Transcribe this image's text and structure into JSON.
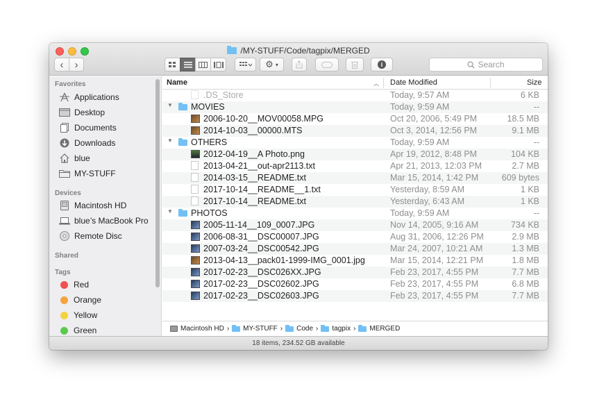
{
  "window": {
    "title": "/MY-STUFF/Code/tagpix/MERGED"
  },
  "toolbar": {
    "back": "‹",
    "forward": "›",
    "search_placeholder": "Search"
  },
  "sidebar": {
    "favorites_label": "Favorites",
    "favorites": [
      {
        "label": "Applications",
        "icon": "applications-icon"
      },
      {
        "label": "Desktop",
        "icon": "desktop-icon"
      },
      {
        "label": "Documents",
        "icon": "documents-icon"
      },
      {
        "label": "Downloads",
        "icon": "downloads-icon"
      },
      {
        "label": "blue",
        "icon": "home-icon"
      },
      {
        "label": "MY-STUFF",
        "icon": "folder-icon"
      }
    ],
    "devices_label": "Devices",
    "devices": [
      {
        "label": "Macintosh HD",
        "icon": "hard-drive-icon"
      },
      {
        "label": "blue’s MacBook Pro",
        "icon": "laptop-icon"
      },
      {
        "label": "Remote Disc",
        "icon": "disc-icon"
      }
    ],
    "shared_label": "Shared",
    "tags_label": "Tags",
    "tags": [
      {
        "label": "Red",
        "color": "#f2504e"
      },
      {
        "label": "Orange",
        "color": "#f5a33c"
      },
      {
        "label": "Yellow",
        "color": "#f5d13c"
      },
      {
        "label": "Green",
        "color": "#5bc94e"
      }
    ]
  },
  "list": {
    "columns": {
      "name": "Name",
      "date": "Date Modified",
      "size": "Size"
    },
    "rows": [
      {
        "name": ".DS_Store",
        "date": "Today, 9:57 AM",
        "size": "6 KB",
        "level": 1,
        "kind": "doc",
        "dim": true
      },
      {
        "name": "MOVIES",
        "date": "Today, 9:59 AM",
        "size": "--",
        "level": 0,
        "kind": "folder"
      },
      {
        "name": "2006-10-20__MOV00058.MPG",
        "date": "Oct 20, 2006, 5:49 PM",
        "size": "18.5 MB",
        "level": 1,
        "kind": "img"
      },
      {
        "name": "2014-10-03__00000.MTS",
        "date": "Oct 3, 2014, 12:56 PM",
        "size": "9.1 MB",
        "level": 1,
        "kind": "img"
      },
      {
        "name": "OTHERS",
        "date": "Today, 9:59 AM",
        "size": "--",
        "level": 0,
        "kind": "folder"
      },
      {
        "name": "2012-04-19__A Photo.png",
        "date": "Apr 19, 2012, 8:48 PM",
        "size": "104 KB",
        "level": 1,
        "kind": "png"
      },
      {
        "name": "2013-04-21__out-apr2113.txt",
        "date": "Apr 21, 2013, 12:03 PM",
        "size": "2.7 MB",
        "level": 1,
        "kind": "doc"
      },
      {
        "name": "2014-03-15__README.txt",
        "date": "Mar 15, 2014, 1:42 PM",
        "size": "609 bytes",
        "level": 1,
        "kind": "doc"
      },
      {
        "name": "2017-10-14__README__1.txt",
        "date": "Yesterday, 8:59 AM",
        "size": "1 KB",
        "level": 1,
        "kind": "doc"
      },
      {
        "name": "2017-10-14__README.txt",
        "date": "Yesterday, 6:43 AM",
        "size": "1 KB",
        "level": 1,
        "kind": "doc"
      },
      {
        "name": "PHOTOS",
        "date": "Today, 9:59 AM",
        "size": "--",
        "level": 0,
        "kind": "folder"
      },
      {
        "name": "2005-11-14__109_0007.JPG",
        "date": "Nov 14, 2005, 9:16 AM",
        "size": "734 KB",
        "level": 1,
        "kind": "img2"
      },
      {
        "name": "2006-08-31__DSC00007.JPG",
        "date": "Aug 31, 2006, 12:26 PM",
        "size": "2.9 MB",
        "level": 1,
        "kind": "img2"
      },
      {
        "name": "2007-03-24__DSC00542.JPG",
        "date": "Mar 24, 2007, 10:21 AM",
        "size": "1.3 MB",
        "level": 1,
        "kind": "img2"
      },
      {
        "name": "2013-04-13__pack01-1999-IMG_0001.jpg",
        "date": "Mar 15, 2014, 12:21 PM",
        "size": "1.8 MB",
        "level": 1,
        "kind": "img"
      },
      {
        "name": "2017-02-23__DSC026XX.JPG",
        "date": "Feb 23, 2017, 4:55 PM",
        "size": "7.7 MB",
        "level": 1,
        "kind": "img2"
      },
      {
        "name": "2017-02-23__DSC02602.JPG",
        "date": "Feb 23, 2017, 4:55 PM",
        "size": "6.8 MB",
        "level": 1,
        "kind": "img2"
      },
      {
        "name": "2017-02-23__DSC02603.JPG",
        "date": "Feb 23, 2017, 4:55 PM",
        "size": "7.7 MB",
        "level": 1,
        "kind": "img2"
      }
    ]
  },
  "pathbar": [
    "Macintosh HD",
    "MY-STUFF",
    "Code",
    "tagpix",
    "MERGED"
  ],
  "pathbar_sep": "›",
  "status": "18 items, 234.52 GB available"
}
